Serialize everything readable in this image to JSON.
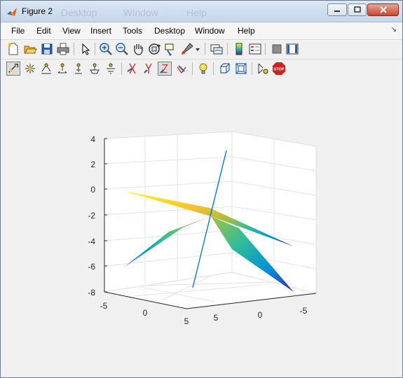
{
  "window": {
    "title": "Figure 2",
    "background_menu_ghost": [
      "Desktop",
      "Window",
      "Help"
    ]
  },
  "menubar": {
    "items": [
      "File",
      "Edit",
      "View",
      "Insert",
      "Tools",
      "Desktop",
      "Window",
      "Help"
    ]
  },
  "toolbar1": {
    "icons": [
      "new-figure-icon",
      "open-file-icon",
      "save-icon",
      "print-icon",
      "edit-plot-arrow-icon",
      "zoom-in-icon",
      "zoom-out-icon",
      "pan-hand-icon",
      "rotate-3d-icon",
      "data-cursor-icon",
      "brush-icon",
      "brush-dropdown-icon",
      "link-plot-icon",
      "colorbar-icon",
      "legend-icon",
      "hide-plot-tools-icon",
      "show-plot-tools-icon"
    ]
  },
  "toolbar2": {
    "icons": [
      "camera-orbit-icon",
      "camera-light-icon",
      "camera-pan-tilt-icon",
      "camera-move-horizontal-icon",
      "camera-move-forward-icon",
      "camera-zoom-icon",
      "camera-roll-icon",
      "x-principal-axis-icon",
      "y-principal-axis-icon",
      "z-principal-axis-icon",
      "no-principal-axis-icon",
      "scene-light-icon",
      "orthographic-projection-icon",
      "perspective-projection-icon",
      "reset-camera-icon",
      "stop-camera-icon"
    ],
    "stop_label": "STOP"
  },
  "chart_data": {
    "type": "surface3d",
    "title": "",
    "xlabel": "",
    "ylabel": "",
    "zlabel": "",
    "x_ticks": [
      "-5",
      "0",
      "5"
    ],
    "y_ticks": [
      "5",
      "0",
      "-5"
    ],
    "z_ticks": [
      "4",
      "2",
      "0",
      "-2",
      "-4",
      "-6",
      "-8"
    ],
    "xlim": [
      -5,
      5
    ],
    "ylim": [
      -5,
      5
    ],
    "zlim": [
      -8,
      4
    ],
    "grid": true,
    "colormap": [
      "#3e26a8",
      "#0091d8",
      "#30bd9a",
      "#a9be40",
      "#f9c02f",
      "#f9fb14"
    ],
    "line_color": "#0072bd",
    "surface_corner_z": {
      "left": 0,
      "right": -8,
      "near_left": -6,
      "far": -4.3,
      "center": -2
    },
    "line_z_range": [
      -7.6,
      3.4
    ]
  }
}
